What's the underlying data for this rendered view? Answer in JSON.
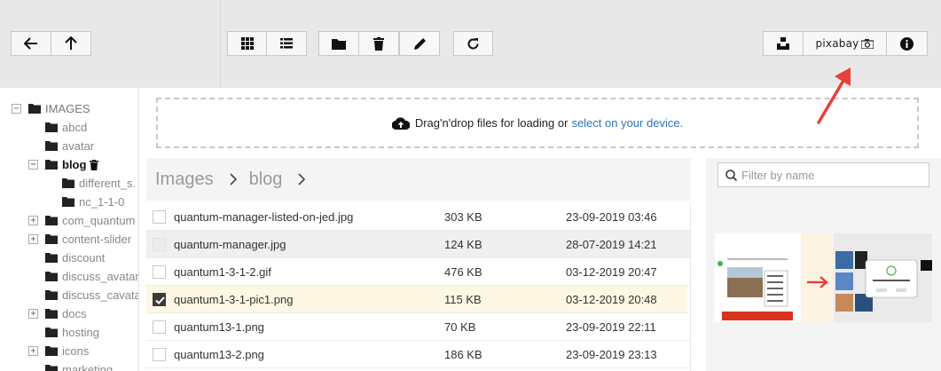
{
  "toolbar": {
    "pixabay_label": "pixabay"
  },
  "tree": [
    {
      "label": "IMAGES",
      "toggle": "−"
    },
    {
      "label": "abcd",
      "toggle": ""
    },
    {
      "label": "avatar",
      "toggle": ""
    },
    {
      "label": "blog",
      "toggle": "−"
    },
    {
      "label": "different_s.",
      "toggle": ""
    },
    {
      "label": "nc_1-1-0",
      "toggle": ""
    },
    {
      "label": "com_quantum",
      "toggle": "+"
    },
    {
      "label": "content-slider",
      "toggle": "+"
    },
    {
      "label": "discount",
      "toggle": ""
    },
    {
      "label": "discuss_avatar",
      "toggle": ""
    },
    {
      "label": "discuss_cavata",
      "toggle": ""
    },
    {
      "label": "docs",
      "toggle": "+"
    },
    {
      "label": "hosting",
      "toggle": ""
    },
    {
      "label": "icons",
      "toggle": "+"
    },
    {
      "label": "marketing",
      "toggle": ""
    }
  ],
  "upload": {
    "text": "Drag'n'drop files for loading or",
    "link": "select on your device."
  },
  "breadcrumb": [
    "Images",
    "blog"
  ],
  "filter": {
    "placeholder": "Filter by name"
  },
  "files": [
    {
      "name": "quantum-manager-listed-on-jed.jpg",
      "size": "303 KB",
      "date": "23-09-2019 03:46"
    },
    {
      "name": "quantum-manager.jpg",
      "size": "124 KB",
      "date": "28-07-2019 14:21"
    },
    {
      "name": "quantum1-3-1-2.gif",
      "size": "476 KB",
      "date": "03-12-2019 20:47"
    },
    {
      "name": "quantum1-3-1-pic1.png",
      "size": "115 KB",
      "date": "03-12-2019 20:48"
    },
    {
      "name": "quantum13-1.png",
      "size": "70 KB",
      "date": "23-09-2019 22:11"
    },
    {
      "name": "quantum13-2.png",
      "size": "186 KB",
      "date": "23-09-2019 23:13"
    }
  ],
  "colors": {
    "toolbar_bg": "#e9e8e8",
    "link": "#2a73c9",
    "selected_row": "#fdf7e3",
    "annotation_arrow": "#e8403a"
  }
}
